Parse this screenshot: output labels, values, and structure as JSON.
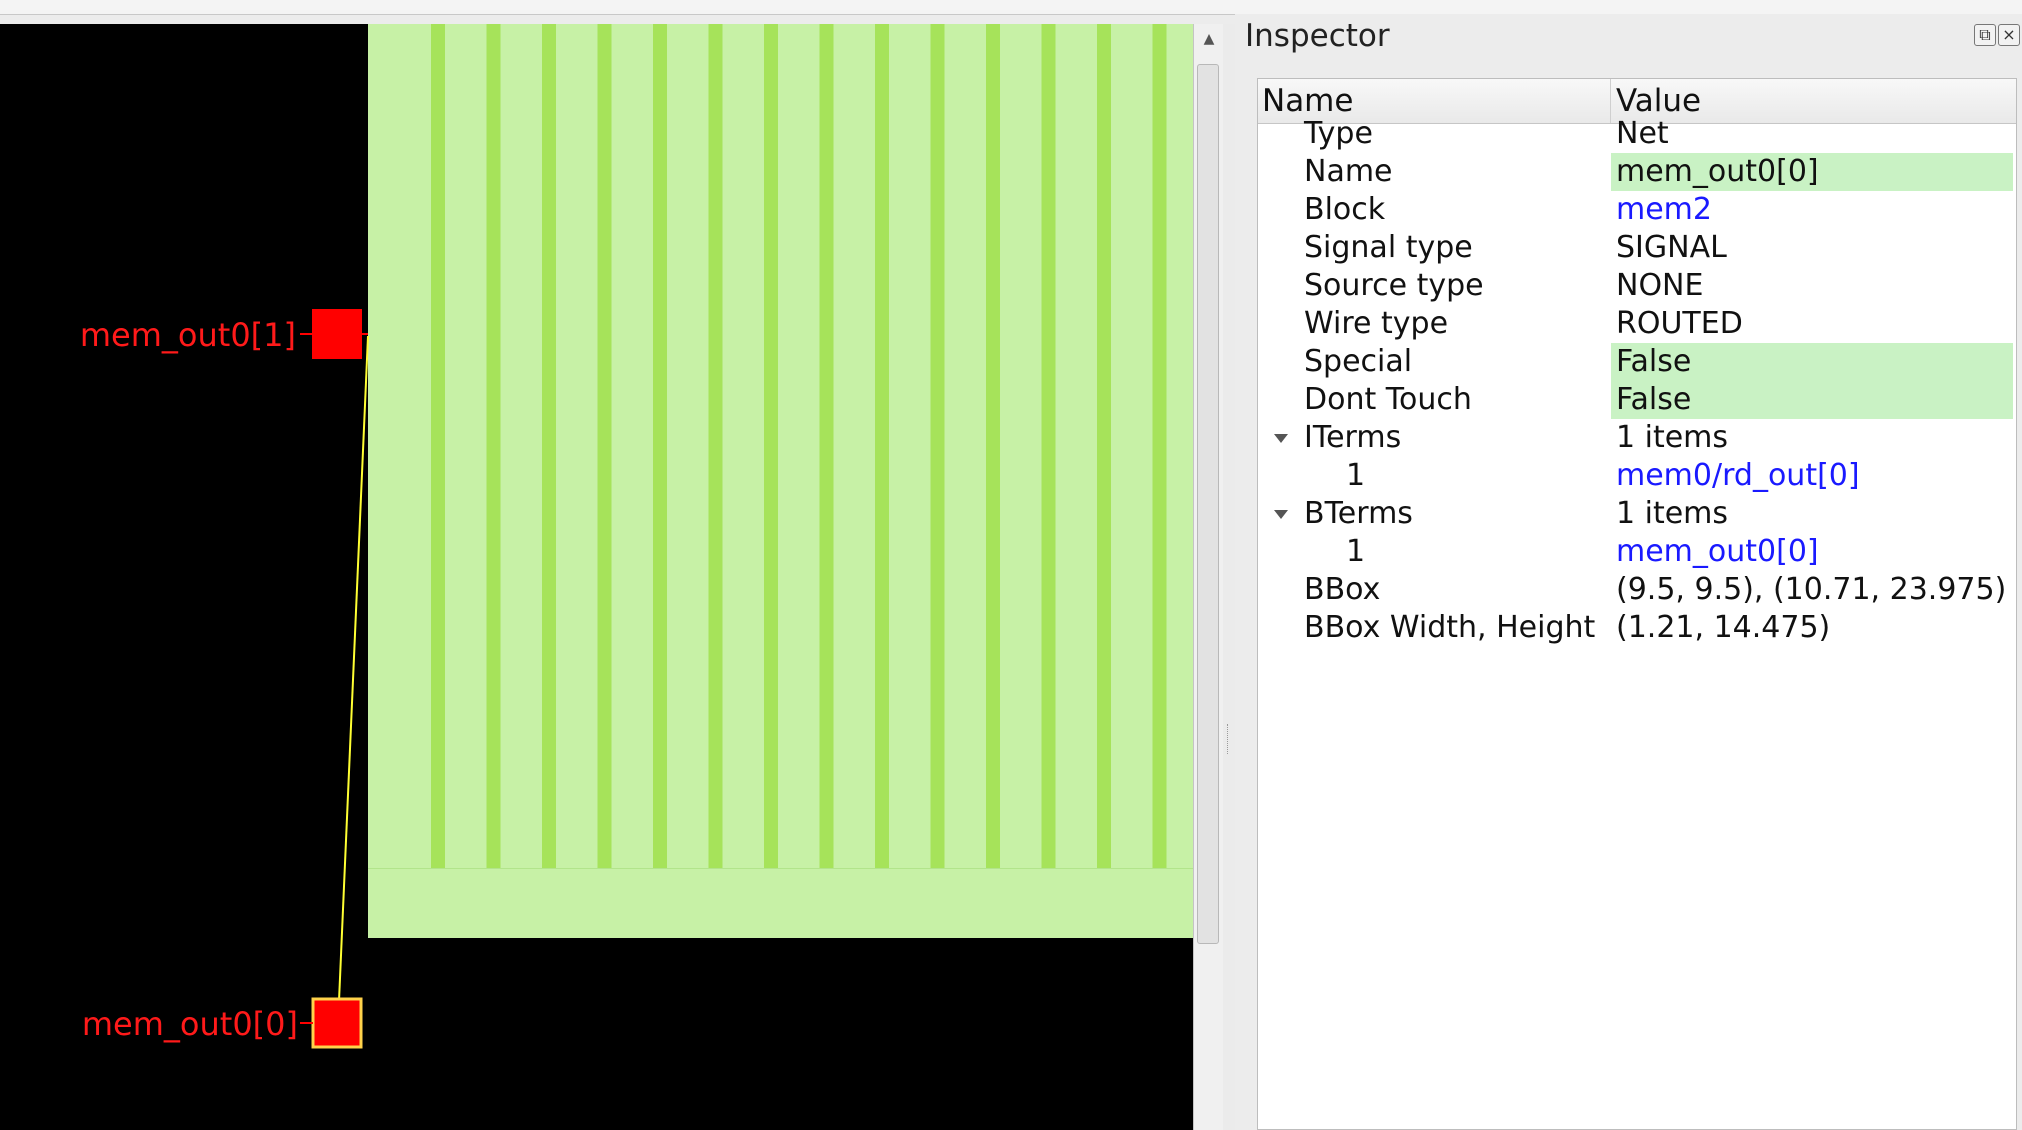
{
  "layout": {
    "pins": [
      {
        "label": "mem_out0[1]"
      },
      {
        "label": "mem_out0[0]"
      }
    ],
    "colors": {
      "background": "#000000",
      "macro_fill": "#c7f1a6",
      "macro_stripe": "#a6e35a",
      "pin_fill": "#ff0000",
      "pin_label": "#ff1a1a",
      "highlight_net": "#ffff33"
    }
  },
  "inspector": {
    "title": "Inspector",
    "dock_icons": [
      "float-icon",
      "close-icon"
    ],
    "columns": {
      "name": "Name",
      "value": "Value"
    },
    "rows": [
      {
        "name": "Type",
        "value": "Net"
      },
      {
        "name": "Name",
        "value": "mem_out0[0]"
      },
      {
        "name": "Block",
        "value": "mem2"
      },
      {
        "name": "Signal type",
        "value": "SIGNAL"
      },
      {
        "name": "Source type",
        "value": "NONE"
      },
      {
        "name": "Wire type",
        "value": "ROUTED"
      },
      {
        "name": "Special",
        "value": "False"
      },
      {
        "name": "Dont Touch",
        "value": "False"
      },
      {
        "name": "ITerms",
        "value": "1 items"
      },
      {
        "name": "1",
        "value": "mem0/rd_out[0]"
      },
      {
        "name": "BTerms",
        "value": "1 items"
      },
      {
        "name": "1",
        "value": "mem_out0[0]"
      },
      {
        "name": "BBox",
        "value": "(9.5, 9.5), (10.71, 23.975)"
      },
      {
        "name": "BBox Width, Height",
        "value": "(1.21, 14.475)"
      }
    ]
  }
}
